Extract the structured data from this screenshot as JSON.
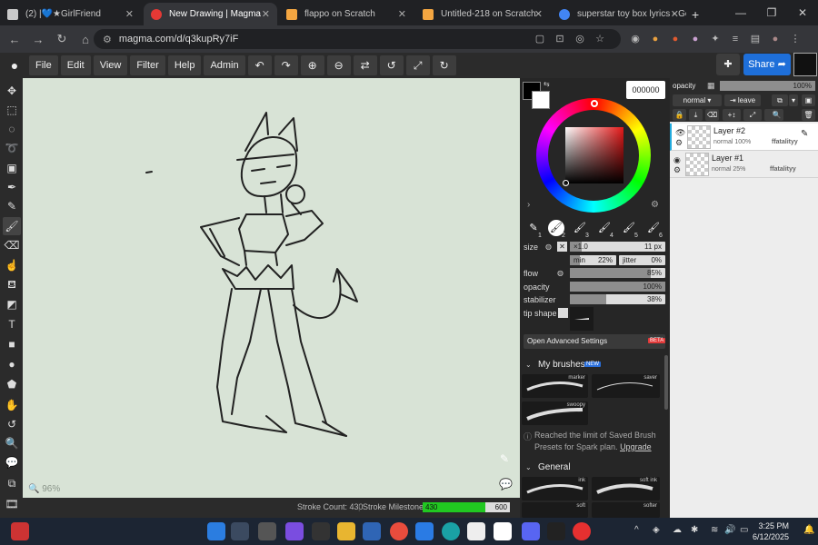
{
  "tabs": [
    {
      "title": "(2) |💙★GirlFriend"
    },
    {
      "title": "New Drawing | Magma"
    },
    {
      "title": "flappo on Scratch"
    },
    {
      "title": "Untitled-218 on Scratch"
    },
    {
      "title": "superstar toy box lyrics - Go"
    }
  ],
  "url": "magma.com/d/q3kupRy7iF",
  "menu": [
    "File",
    "Edit",
    "View",
    "Filter",
    "Help",
    "Admin"
  ],
  "share_label": "Share",
  "zoom": "96%",
  "status": {
    "stroke_count": "Stroke Count: 430",
    "milestone_label": "Stroke Milestone:",
    "milestone_value": "430",
    "milestone_target": "600",
    "milestone_fraction": 0.717
  },
  "color": {
    "hex": "000000"
  },
  "brush_slots": [
    "1",
    "2",
    "3",
    "4",
    "5",
    "6"
  ],
  "brush": {
    "size_label": "size",
    "size_mult": "×1.0",
    "size_value": "11 px",
    "size_fraction": 0.12,
    "min_label": "min",
    "min_value": "22%",
    "min_fraction": 0.22,
    "jitter_label": "jitter",
    "jitter_value": "0%",
    "jitter_fraction": 0.0,
    "flow_label": "flow",
    "flow_value": "85%",
    "flow_fraction": 0.85,
    "opacity_label": "opacity",
    "opacity_value": "100%",
    "opacity_fraction": 1.0,
    "stabilizer_label": "stabilizer",
    "stabilizer_value": "38%",
    "stabilizer_fraction": 0.38,
    "tip_label": "tip shape"
  },
  "advanced_label": "Open Advanced Settings",
  "beta_badge": "BETA",
  "my_brushes_label": "My brushes",
  "new_badge": "NEW",
  "my_brushes": [
    "marker",
    "saver",
    "swoopy"
  ],
  "limit_text": "Reached the limit of Saved Brush Presets for Spark plan.",
  "upgrade_label": "Upgrade",
  "general_label": "General",
  "general_brushes": [
    "ink",
    "soft ink",
    "soft",
    "softer"
  ],
  "layers_panel": {
    "opacity_label": "opacity",
    "opacity_value": "100%",
    "opacity_fraction": 1.0,
    "blend": "normal",
    "leave_label": "leave"
  },
  "layers": [
    {
      "name": "Layer #2",
      "meta": "normal 100%",
      "owner": "ffatalityy"
    },
    {
      "name": "Layer #1",
      "meta": "normal 25%",
      "owner": "ffatalityy"
    }
  ],
  "clock": {
    "time": "3:25 PM",
    "date": "6/12/2025"
  },
  "colors": {
    "share": "#1e6fd9",
    "canvas": "#d8e3d6",
    "milestone": "#21c821",
    "beta": "#e23a3a",
    "new": "#2a6fdb"
  }
}
